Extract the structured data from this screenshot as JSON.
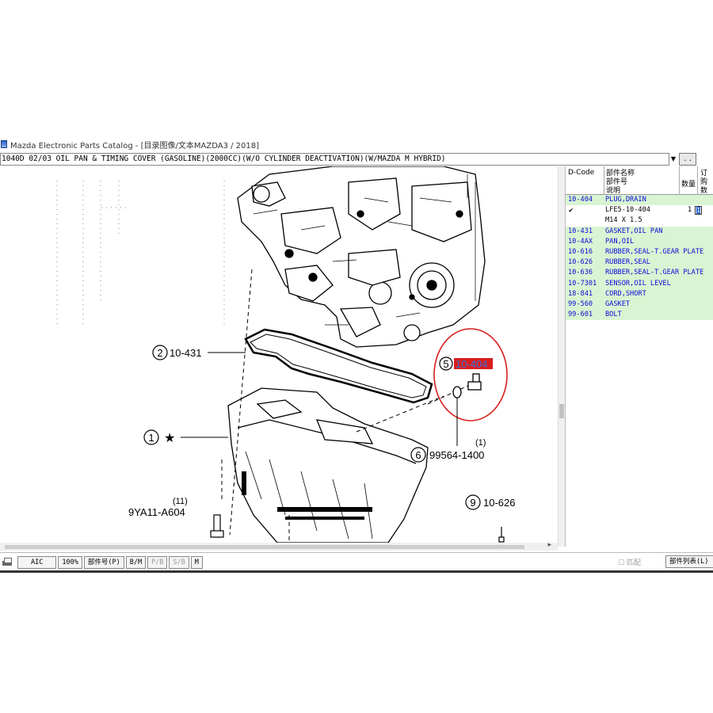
{
  "window": {
    "title": "Mazda Electronic Parts Catalog - [目录图像/文本MAZDA3 / 2018]"
  },
  "breadcrumb": {
    "text": "1040D 02/03 OIL PAN & TIMING COVER (GASOLINE)(2000CC)(W/O CYLINDER DEACTIVATION)(W/MAZDA M HYBRID)",
    "dropdown": "▼",
    "more_button": ". ."
  },
  "diagram": {
    "callouts": [
      {
        "num": "2",
        "part": "10-431"
      },
      {
        "num": "1",
        "part": "★"
      },
      {
        "num": "5",
        "part": "10-404"
      },
      {
        "num": "6",
        "part": "99564-1400",
        "qty": "(1)"
      },
      {
        "num": "9",
        "part": "10-626"
      }
    ],
    "bolt": {
      "qty": "(11)",
      "part": "9YA11-A604"
    },
    "highlight_color": "#d81e1e"
  },
  "table": {
    "headers": {
      "code": "D-Code",
      "name_line1": "部件名称",
      "name_line2": "部件号",
      "name_line3": "说明",
      "qty": "数量",
      "order_line1": "订",
      "order_line2": "购",
      "order_line3": "数"
    },
    "rows": [
      {
        "code": "10-404",
        "name": "PLUG,DRAIN"
      },
      {
        "code": "10-431",
        "name": "GASKET,OIL PAN"
      },
      {
        "code": "10-4AX",
        "name": "PAN,OIL"
      },
      {
        "code": "10-616",
        "name": "RUBBER,SEAL-T.GEAR PLATE"
      },
      {
        "code": "10-626",
        "name": "RUBBER,SEAL"
      },
      {
        "code": "10-636",
        "name": "RUBBER,SEAL-T.GEAR PLATE"
      },
      {
        "code": "10-7301",
        "name": "SENSOR,OIL LEVEL"
      },
      {
        "code": "18-841",
        "name": "CORD,SHORT"
      },
      {
        "code": "99-560",
        "name": "GASKET"
      },
      {
        "code": "99-601",
        "name": "BOLT"
      }
    ],
    "detail": {
      "check": "✔",
      "part_no": "LFE5-10-404",
      "qty": "1",
      "order": "1",
      "spec": "M14 X 1.5"
    }
  },
  "toolbar": {
    "aic": "AIC",
    "zoom": "100%",
    "part_no": "部件号(P)",
    "b_m": "B/M",
    "p_b": "P/B",
    "s_b": "S/B",
    "m": "M",
    "match": "☐ 匹配",
    "parts_list": "部件列表(L)"
  }
}
